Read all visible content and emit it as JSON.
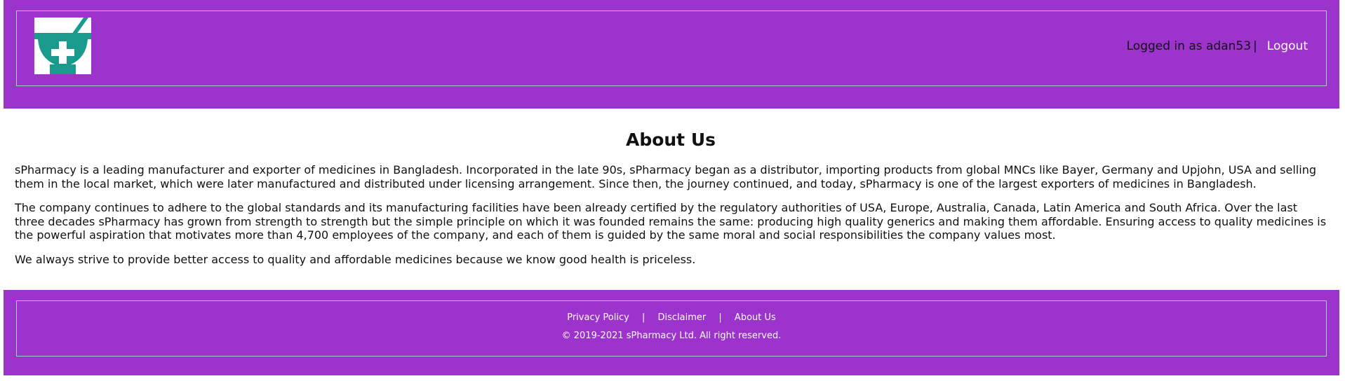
{
  "header": {
    "logo_icon": "mortar-pestle-cross-icon",
    "logged_in_text": "Logged in as adan53",
    "separator": "|",
    "logout_label": "Logout"
  },
  "main": {
    "title": "About Us",
    "paragraphs": [
      "sPharmacy is a leading manufacturer and exporter of medicines in Bangladesh. Incorporated in the late 90s, sPharmacy began as a distributor, importing products from global MNCs like Bayer, Germany and Upjohn, USA and selling them in the local market, which were later manufactured and distributed under licensing arrangement. Since then, the journey continued, and today, sPharmacy is one of the largest exporters of medicines in Bangladesh.",
      "The company continues to adhere to the global standards and its manufacturing facilities have been already certified by the regulatory authorities of USA, Europe, Australia, Canada, Latin America and South Africa. Over the last three decades sPharmacy has grown from strength to strength but the simple principle on which it was founded remains the same: producing high quality generics and making them affordable. Ensuring access to quality medicines is the powerful aspiration that motivates more than 4,700 employees of the company, and each of them is guided by the same moral and social responsibilities the company values most.",
      "We always strive to provide better access to quality and affordable medicines because we know good health is priceless."
    ]
  },
  "footer": {
    "links": [
      "Privacy Policy",
      "Disclaimer",
      "About Us"
    ],
    "separator": "|",
    "copyright": "© 2019-2021 sPharmacy Ltd. All right reserved."
  },
  "colors": {
    "header_bg": "#9b33cc",
    "border": "#9fd3c7",
    "logo_teal": "#1a9a8c"
  }
}
